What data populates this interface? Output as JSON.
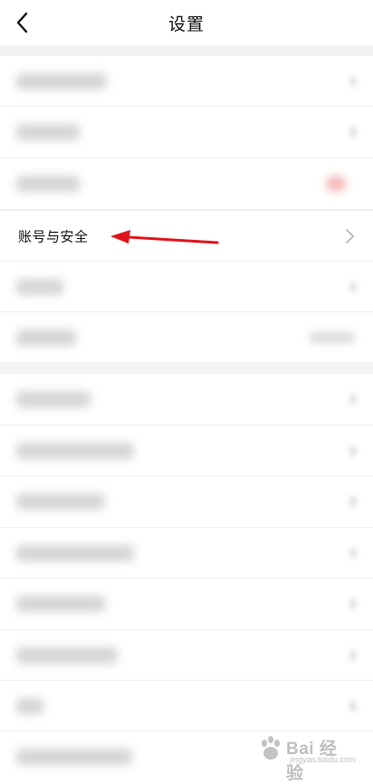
{
  "header": {
    "title": "设置"
  },
  "account_security": {
    "label": "账号与安全"
  },
  "watermark": {
    "text": "Bai 经验",
    "subtext": "jingyan.baidu.com"
  },
  "colors": {
    "annotation_arrow": "#e0141c",
    "section_gap": "#f3f3f4"
  }
}
